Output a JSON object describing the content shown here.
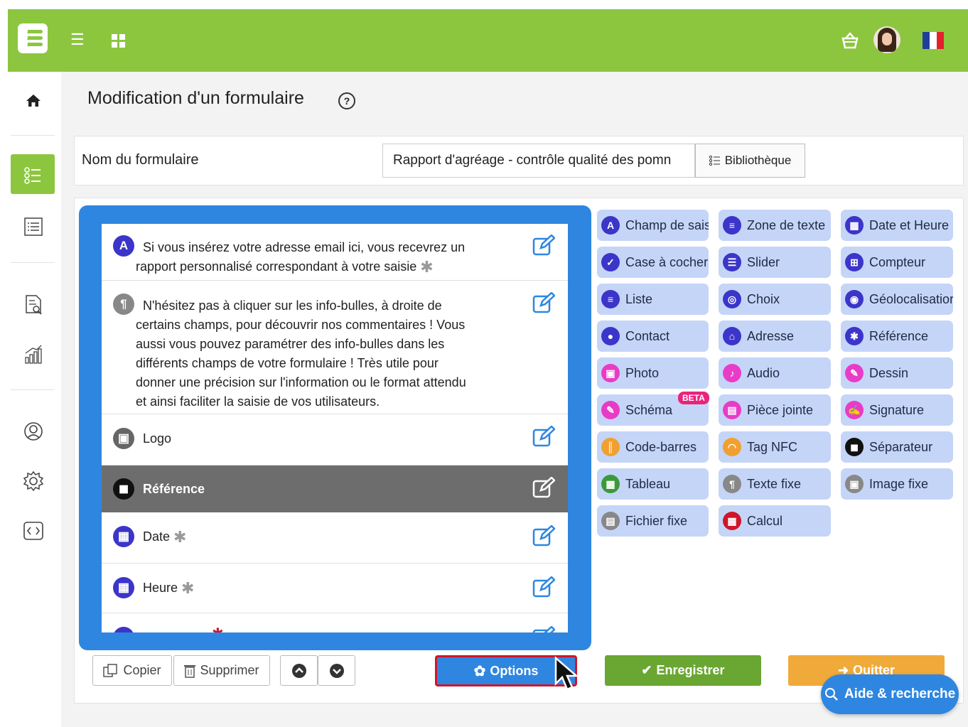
{
  "page": {
    "title": "Modification d'un formulaire",
    "help_icon": "?"
  },
  "form": {
    "name_label": "Nom du formulaire",
    "name_value": "Rapport d'agréage - contrôle qualité des pomn",
    "library_button": "Bibliothèque"
  },
  "fields": [
    {
      "icon": "A",
      "icon_color": "#3b35c9",
      "line1": "Si vous insérez votre adresse email ici, vous recevrez un",
      "line2": "rapport personnalisé correspondant à votre saisie",
      "required": "✱"
    },
    {
      "icon": "¶",
      "icon_color": "#888888",
      "lines": [
        "N'hésitez pas à cliquer sur les info-bulles, à droite de",
        "certains champs, pour découvrir nos commentaires ! Vous",
        "aussi vous pouvez paramétrer des info-bulles dans les",
        "différents champs de votre formulaire ! Très utile pour",
        "donner une précision sur l'information ou le format attendu",
        "et ainsi faciliter la saisie de vos utilisateurs."
      ]
    },
    {
      "icon": "▣",
      "icon_color": "#666666",
      "label": "Logo"
    },
    {
      "icon": "◼",
      "icon_color": "#111111",
      "label": "Référence",
      "selected": true
    },
    {
      "icon": "▦",
      "icon_color": "#3b35c9",
      "label": "Date",
      "required": "✱"
    },
    {
      "icon": "▦",
      "icon_color": "#3b35c9",
      "label": "Heure",
      "required": "✱"
    }
  ],
  "palette": [
    {
      "label": "Champ de saisi",
      "icon": "A",
      "color": "#3b35c9"
    },
    {
      "label": "Zone de texte",
      "icon": "≡",
      "color": "#3b35c9"
    },
    {
      "label": "Date et Heure",
      "icon": "▦",
      "color": "#3b35c9"
    },
    {
      "label": "Case à cocher",
      "icon": "✓",
      "color": "#3b35c9"
    },
    {
      "label": "Slider",
      "icon": "☰",
      "color": "#3b35c9"
    },
    {
      "label": "Compteur",
      "icon": "⊞",
      "color": "#3b35c9"
    },
    {
      "label": "Liste",
      "icon": "≡",
      "color": "#3b35c9"
    },
    {
      "label": "Choix",
      "icon": "◎",
      "color": "#3b35c9"
    },
    {
      "label": "Géolocalisatior",
      "icon": "◉",
      "color": "#3b35c9"
    },
    {
      "label": "Contact",
      "icon": "●",
      "color": "#3b35c9"
    },
    {
      "label": "Adresse",
      "icon": "⌂",
      "color": "#3b35c9"
    },
    {
      "label": "Référence",
      "icon": "✱",
      "color": "#3b35c9"
    },
    {
      "label": "Photo",
      "icon": "▣",
      "color": "#e83cc8"
    },
    {
      "label": "Audio",
      "icon": "♪",
      "color": "#e83cc8"
    },
    {
      "label": "Dessin",
      "icon": "✎",
      "color": "#e83cc8"
    },
    {
      "label": "Schéma",
      "icon": "✎",
      "color": "#e83cc8"
    },
    {
      "label": "Pièce jointe",
      "icon": "▤",
      "color": "#e83cc8"
    },
    {
      "label": "Signature",
      "icon": "✍",
      "color": "#e83cc8"
    },
    {
      "label": "Code-barres",
      "icon": "║",
      "color": "#f0a030"
    },
    {
      "label": "Tag NFC",
      "icon": "◠",
      "color": "#f0a030"
    },
    {
      "label": "Séparateur",
      "icon": "◼",
      "color": "#111111"
    },
    {
      "label": "Tableau",
      "icon": "▦",
      "color": "#3a9a3a"
    },
    {
      "label": "Texte fixe",
      "icon": "¶",
      "color": "#888888"
    },
    {
      "label": "Image fixe",
      "icon": "▣",
      "color": "#888888"
    },
    {
      "label": "Fichier fixe",
      "icon": "▤",
      "color": "#888888"
    },
    {
      "label": "Calcul",
      "icon": "▦",
      "color": "#d0152a"
    }
  ],
  "beta_badge": "BETA",
  "actions": {
    "copy": "Copier",
    "delete": "Supprimer",
    "options": "Options",
    "save": "Enregistrer",
    "quit": "Quitter",
    "help_search": "Aide & recherche"
  },
  "colors": {
    "brand_green": "#8cc63f",
    "accent_blue": "#2e86e0",
    "palette_bg": "#c5d5f8"
  }
}
